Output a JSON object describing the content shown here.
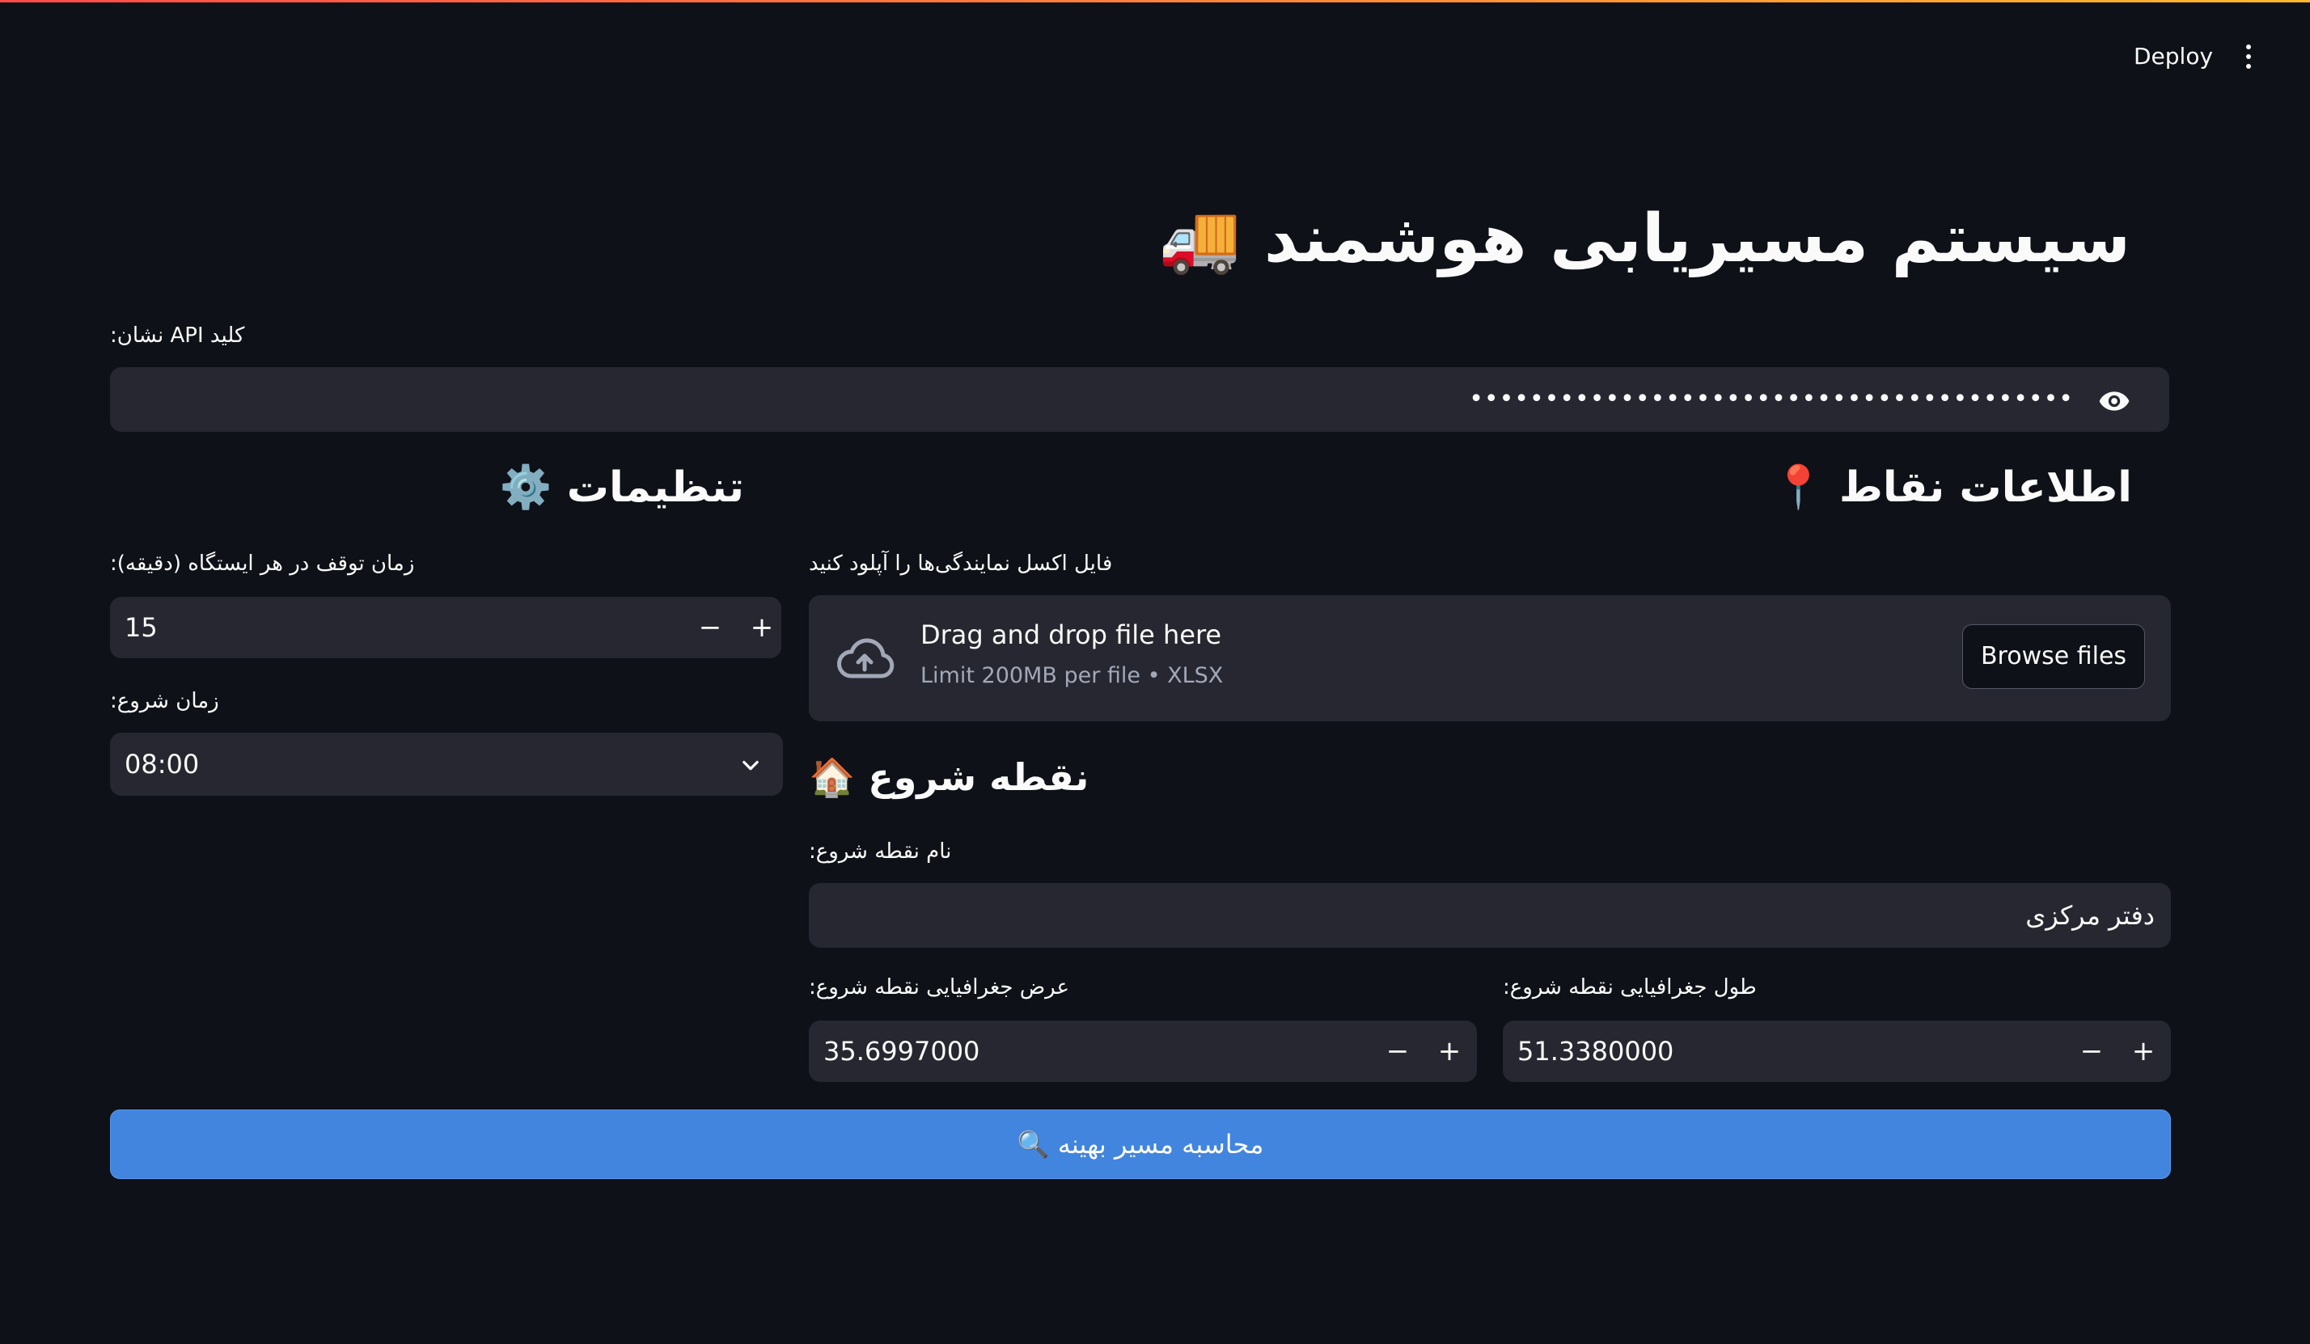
{
  "header": {
    "deploy_label": "Deploy",
    "menu_icon": "kebab-menu-icon"
  },
  "title": "سیستم مسیریابی هوشمند 🚚",
  "api_key": {
    "label": "کلید API نشان:",
    "value": "••••••••••••••••••••••••••••••••••••••••",
    "icon": "eye-icon"
  },
  "points_section": {
    "heading": "اطلاعات نقاط 📍",
    "upload_label": "فایل اکسل نمایندگی‌ها را آپلود کنید",
    "dropzone_text": "Drag and drop file here",
    "dropzone_limit": "Limit 200MB per file • XLSX",
    "browse_label": "Browse files",
    "upload_icon": "cloud-upload-icon"
  },
  "settings_section": {
    "heading": "تنظیمات ⚙️",
    "stop_time_label": "زمان توقف در هر ایستگاه (دقیقه):",
    "stop_time_value": "15",
    "start_time_label": "زمان شروع:",
    "start_time_value": "08:00"
  },
  "start_section": {
    "heading": "نقطه شروع 🏠",
    "name_label": "نام نقطه شروع:",
    "name_value": "دفتر مرکزی",
    "lat_label": "عرض جغرافیایی نقطه شروع:",
    "lat_value": "35.6997000",
    "lon_label": "طول جغرافیایی نقطه شروع:",
    "lon_value": "51.3380000"
  },
  "stepper": {
    "minus": "−",
    "plus": "+"
  },
  "calculate_button": "محاسبه مسیر بهینه 🔍"
}
